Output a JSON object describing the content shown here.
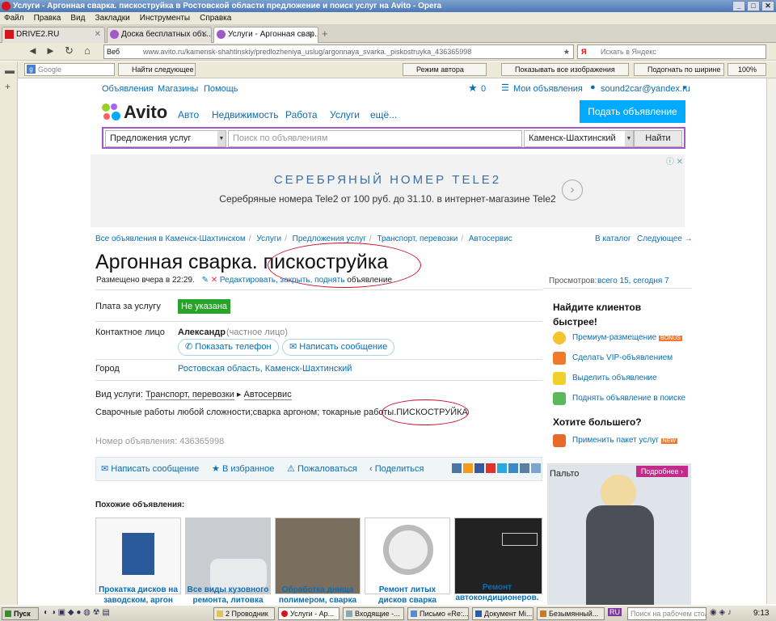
{
  "window": {
    "title": "Услуги - Аргонная сварка. пискоструйка в Ростовской области предложение и поиск услуг на Avito - Opera"
  },
  "menu": [
    "Файл",
    "Правка",
    "Вид",
    "Закладки",
    "Инструменты",
    "Справка"
  ],
  "tabs": [
    {
      "label": "DRIVE2.RU"
    },
    {
      "label": "Доска бесплатных объ..."
    },
    {
      "label": "Услуги - Аргонная свар..."
    }
  ],
  "address": {
    "prefix": "Веб",
    "url": "www.avito.ru/kamensk-shahtinskiy/predlozheniya_uslug/argonnaya_svarka._piskostruyka_436365998",
    "search_placeholder": "Искать в Яндекс"
  },
  "toolbar2": {
    "google": "Google",
    "find_next": "Найти следующее",
    "author_mode": "Режим автора",
    "show_images": "Показывать все изображения",
    "fit_width": "Подогнать по ширине",
    "zoom": "100%"
  },
  "site_top": {
    "links": [
      "Объявления",
      "Магазины",
      "Помощь"
    ],
    "favorites_count": "0",
    "my_ads": "Мои объявления",
    "user": "sound2car@yandex.ru"
  },
  "header": {
    "logo": "Avito",
    "categories": [
      "Авто",
      "Недвижимость",
      "Работа",
      "Услуги",
      "ещё..."
    ],
    "post_button": "Подать объявление"
  },
  "search": {
    "category": "Предложения услуг",
    "placeholder": "Поиск по объявлениям",
    "city": "Каменск-Шахтинский",
    "find_button": "Найти"
  },
  "banner": {
    "title": "СЕРЕБРЯНЫЙ НОМЕР TELE2",
    "text": "Серебряные номера Tele2 от 100 руб. до 31.10. в интернет-магазине Tele2"
  },
  "breadcrumbs": [
    "Все объявления в Каменск-Шахтинском",
    "Услуги",
    "Предложения услуг",
    "Транспорт, перевозки",
    "Автосервис"
  ],
  "catalog_nav": {
    "catalog": "В каталог",
    "next": "Следующее →"
  },
  "ad": {
    "title": "Аргонная сварка. пискоструйка",
    "posted": "Размещено вчера в 22:29.",
    "edit_links": "Редактировать, закрыть, поднять",
    "edit_suffix": "объявление",
    "views_label": "Просмотров:",
    "views_value": "всего 15, сегодня 7",
    "price_label": "Плата за услугу",
    "price_value": "Не указана",
    "contact_label": "Контактное лицо",
    "contact_name": "Александр",
    "contact_type": "(частное лицо)",
    "show_phone": "Показать телефон",
    "write_message": "Написать сообщение",
    "city_label": "Город",
    "city_value": "Ростовская область, Каменск-Шахтинский",
    "service_type_label": "Вид услуги:",
    "service_type_1": "Транспорт, перевозки",
    "service_type_2": "Автосервис",
    "description": "Сварочные работы любой сложности;сварка аргоном; токарные работы.ПИСКОСТРУЙКА",
    "number": "Номер объявления: 436365998"
  },
  "actions": {
    "write": "Написать сообщение",
    "favorite": "В избранное",
    "complain": "Пожаловаться",
    "share": "Поделиться"
  },
  "similar": {
    "heading": "Похожие объявления:",
    "items": [
      {
        "title": "Прокатка дисков на заводском, аргон"
      },
      {
        "title": "Все виды кузовного ремонта, литовка"
      },
      {
        "title": "Обработка днища полимером, сварка"
      },
      {
        "title": "Ремонт литых дисков сварка"
      },
      {
        "title": "Ремонт автокондиционеров."
      }
    ]
  },
  "sidebar": {
    "heading1": "Найдите клиентов быстрее!",
    "items": [
      {
        "label": "Премиум-размещение",
        "badge": "BONUS"
      },
      {
        "label": "Сделать VIP-объявлением"
      },
      {
        "label": "Выделить объявление"
      },
      {
        "label": "Поднять объявление в поиске"
      }
    ],
    "heading2": "Хотите большего?",
    "package": "Применить пакет услуг",
    "package_badge": "NEW"
  },
  "ad_box": {
    "label": "Пальто",
    "button": "Подробнее ›"
  },
  "taskbar": {
    "start": "Пуск",
    "items": [
      "2 Проводник",
      "Услуги - Ар...",
      "Входящие -...",
      "Письмо «Re:...",
      "Документ Mi...",
      "Безымянный..."
    ],
    "lang": "RU",
    "search": "Поиск на рабочем столе",
    "time": "9:13"
  },
  "colors": {
    "link": "#0a6eb4",
    "post_button": "#00aaff",
    "price_badge": "#28a228",
    "search_border": "#a05ac8",
    "annotation": "#c8102e"
  }
}
